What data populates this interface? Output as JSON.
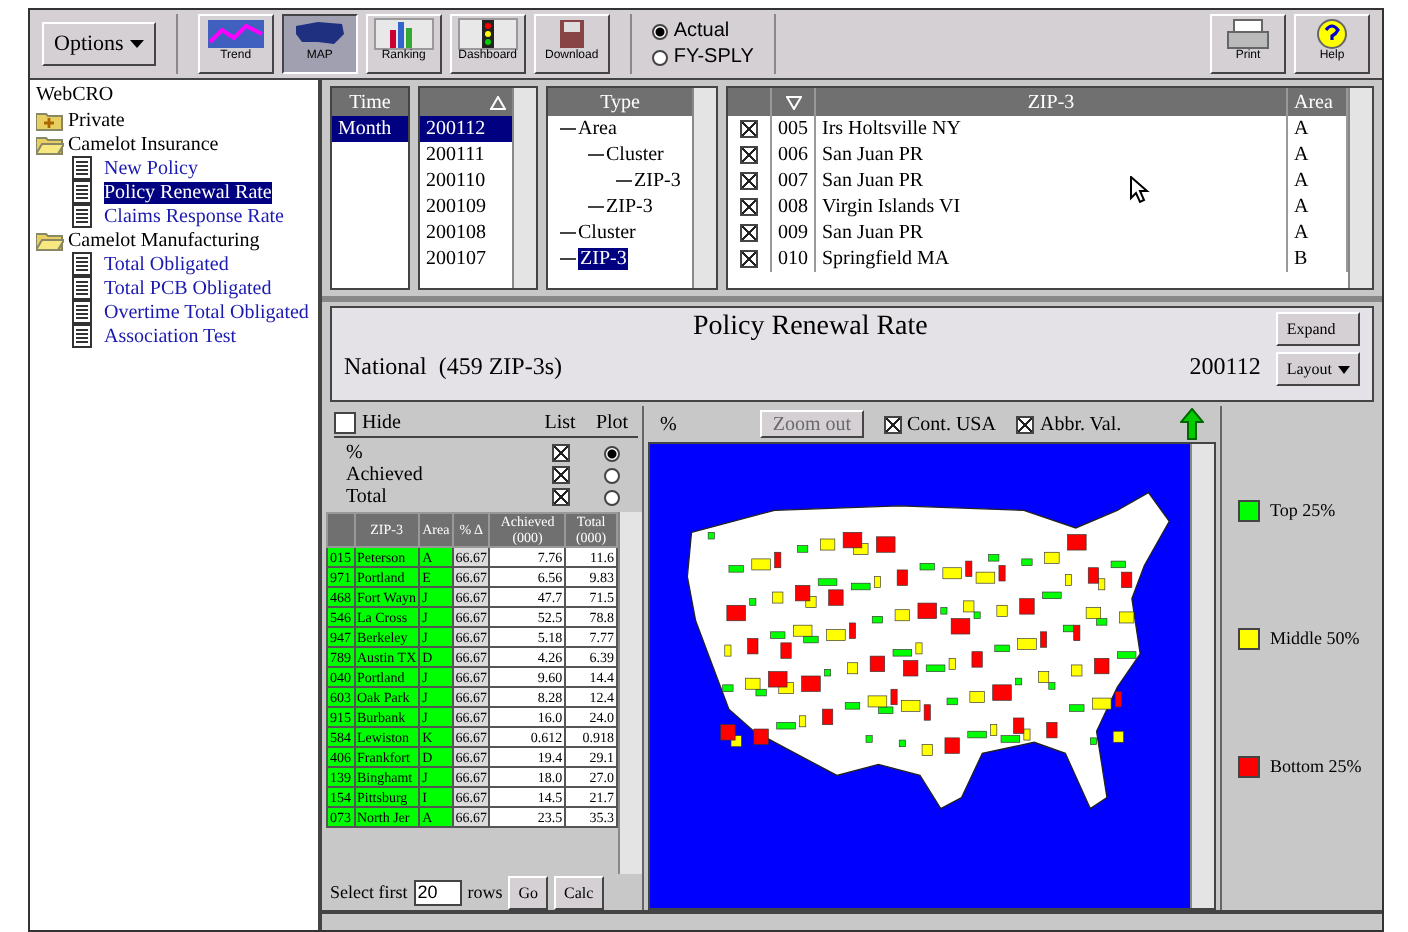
{
  "toolbar": {
    "options": "Options",
    "tools": [
      {
        "kind": "trend",
        "label": "Trend",
        "selected": false
      },
      {
        "kind": "map",
        "label": "MAP",
        "selected": true
      },
      {
        "kind": "ranking",
        "label": "Ranking",
        "selected": false
      },
      {
        "kind": "dashboard",
        "label": "Dashboard",
        "selected": false
      },
      {
        "kind": "download",
        "label": "Download",
        "selected": false
      }
    ],
    "radios": [
      {
        "label": "Actual",
        "selected": true
      },
      {
        "label": "FY-SPLY",
        "selected": false
      }
    ],
    "right_tools": [
      {
        "kind": "print",
        "label": "Print"
      },
      {
        "kind": "help",
        "label": "Help"
      }
    ]
  },
  "sidebar": {
    "root": "WebCRO",
    "items": [
      {
        "kind": "folder",
        "label": "Private",
        "expanded": false,
        "selected": false
      },
      {
        "kind": "folder",
        "label": "Camelot Insurance",
        "expanded": true,
        "selected": false,
        "children": [
          {
            "kind": "report",
            "label": "New Policy",
            "selected": false
          },
          {
            "kind": "report",
            "label": "Policy Renewal Rate",
            "selected": true
          },
          {
            "kind": "report",
            "label": "Claims Response Rate",
            "selected": false
          }
        ]
      },
      {
        "kind": "folder",
        "label": "Camelot Manufacturing",
        "expanded": true,
        "selected": false,
        "children": [
          {
            "kind": "report",
            "label": "Total Obligated",
            "selected": false
          },
          {
            "kind": "report",
            "label": "Total PCB Obligated",
            "selected": false
          },
          {
            "kind": "report",
            "label": "Overtime Total Obligated",
            "selected": false
          },
          {
            "kind": "report",
            "label": "Association Test",
            "selected": false
          }
        ]
      }
    ]
  },
  "time_list": {
    "header": "Time",
    "items": [
      {
        "label": "Month",
        "selected": true
      }
    ]
  },
  "period_list": {
    "items": [
      {
        "label": "200112",
        "selected": true
      },
      {
        "label": "200111",
        "selected": false
      },
      {
        "label": "200110",
        "selected": false
      },
      {
        "label": "200109",
        "selected": false
      },
      {
        "label": "200108",
        "selected": false
      },
      {
        "label": "200107",
        "selected": false
      }
    ]
  },
  "type_tree": {
    "header": "Type",
    "items": [
      {
        "label": "Area",
        "selected": false,
        "children": [
          {
            "label": "Cluster",
            "selected": false,
            "children": [
              {
                "label": "ZIP-3",
                "selected": false
              }
            ]
          },
          {
            "label": "ZIP-3",
            "selected": false
          }
        ]
      },
      {
        "label": "Cluster",
        "selected": false
      },
      {
        "label": "ZIP-3",
        "selected": true
      }
    ]
  },
  "zip_list": {
    "columns": [
      "ZIP-3",
      "Area"
    ],
    "rows": [
      {
        "checked": true,
        "code": "005",
        "name": "Irs Holtsville NY",
        "area": "A"
      },
      {
        "checked": true,
        "code": "006",
        "name": "San Juan PR",
        "area": "A"
      },
      {
        "checked": true,
        "code": "007",
        "name": "San Juan PR",
        "area": "A"
      },
      {
        "checked": true,
        "code": "008",
        "name": "Virgin Islands VI",
        "area": "A"
      },
      {
        "checked": true,
        "code": "009",
        "name": "San Juan PR",
        "area": "A"
      },
      {
        "checked": true,
        "code": "010",
        "name": "Springfield MA",
        "area": "B"
      }
    ]
  },
  "report": {
    "title": "Policy Renewal Rate",
    "scope": "National  (459 ZIP-3s)",
    "period": "200112",
    "buttons": [
      "Expand",
      "Layout"
    ]
  },
  "options_panel": {
    "hide": {
      "label": "Hide",
      "checked": false
    },
    "headers": [
      "List",
      "Plot"
    ],
    "measures": [
      {
        "label": "%",
        "listed": true,
        "plotted": true
      },
      {
        "label": "Achieved",
        "listed": true,
        "plotted": false
      },
      {
        "label": "Total",
        "listed": true,
        "plotted": false
      }
    ]
  },
  "table": {
    "columns": [
      "",
      "ZIP-3",
      "Area",
      "% Δ",
      "Achieved (000)",
      "Total (000)"
    ],
    "rows": [
      {
        "color": "#00ff00",
        "cells": [
          "015",
          "Peterson",
          "A",
          "66.67",
          "7.76",
          "11.6"
        ]
      },
      {
        "color": "#00ff00",
        "cells": [
          "971",
          "Portland",
          "E",
          "66.67",
          "6.56",
          "9.83"
        ]
      },
      {
        "color": "#00ff00",
        "cells": [
          "468",
          "Fort Wayn",
          "J",
          "66.67",
          "47.7",
          "71.5"
        ]
      },
      {
        "color": "#00ff00",
        "cells": [
          "546",
          "La Cross",
          "J",
          "66.67",
          "52.5",
          "78.8"
        ]
      },
      {
        "color": "#00ff00",
        "cells": [
          "947",
          "Berkeley",
          "J",
          "66.67",
          "5.18",
          "7.77"
        ]
      },
      {
        "color": "#00ff00",
        "cells": [
          "789",
          "Austin TX",
          "D",
          "66.67",
          "4.26",
          "6.39"
        ]
      },
      {
        "color": "#00ff00",
        "cells": [
          "040",
          "Portland",
          "J",
          "66.67",
          "9.60",
          "14.4"
        ]
      },
      {
        "color": "#00ff00",
        "cells": [
          "603",
          "Oak Park",
          "J",
          "66.67",
          "8.28",
          "12.4"
        ]
      },
      {
        "color": "#00ff00",
        "cells": [
          "915",
          "Burbank",
          "J",
          "66.67",
          "16.0",
          "24.0"
        ]
      },
      {
        "color": "#00ff00",
        "cells": [
          "584",
          "Lewiston",
          "K",
          "66.67",
          "0.612",
          "0.918"
        ]
      },
      {
        "color": "#00ff00",
        "cells": [
          "406",
          "Frankfort",
          "D",
          "66.67",
          "19.4",
          "29.1"
        ]
      },
      {
        "color": "#00ff00",
        "cells": [
          "139",
          "Binghamt",
          "J",
          "66.67",
          "18.0",
          "27.0"
        ]
      },
      {
        "color": "#00ff00",
        "cells": [
          "154",
          "Pittsburg",
          "I",
          "66.67",
          "14.5",
          "21.7"
        ]
      },
      {
        "color": "#00ff00",
        "cells": [
          "073",
          "North Jer",
          "A",
          "66.67",
          "23.5",
          "35.3"
        ]
      }
    ]
  },
  "table_footer": {
    "label": "Select first",
    "value": "20",
    "unit": "rows",
    "buttons": [
      "Go",
      "Calc"
    ]
  },
  "map_toolbar": {
    "measure": "%",
    "zoom": {
      "label": "Zoom out",
      "disabled": true
    },
    "checks": [
      {
        "label": "Cont. USA",
        "checked": true
      },
      {
        "label": "Abbr. Val.",
        "checked": true
      }
    ]
  },
  "legend": [
    {
      "label": "Top 25%",
      "color": "#00ff00"
    },
    {
      "label": "Middle 50%",
      "color": "#ffff00"
    },
    {
      "label": "Bottom 25%",
      "color": "#ff0000"
    }
  ]
}
